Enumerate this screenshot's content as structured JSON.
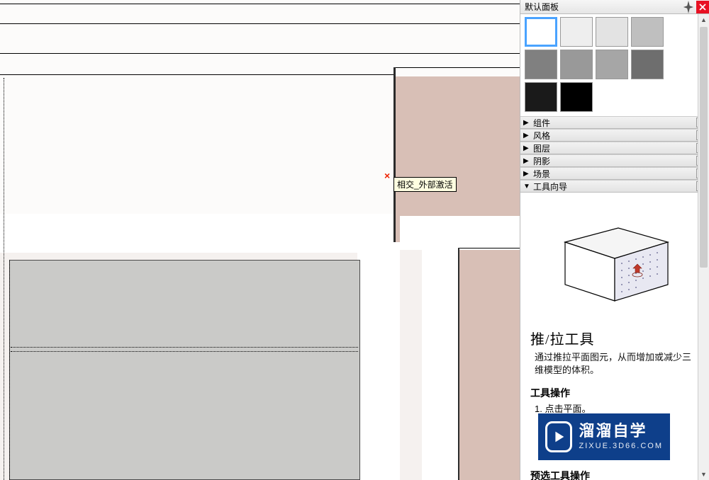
{
  "panel": {
    "title": "默认面板",
    "swatches": [
      [
        "#ffffff",
        "#eeeeee",
        "#e3e3e3",
        "#bfbfbf"
      ],
      [
        "#808080",
        "#999999",
        "#a6a6a6",
        "#6e6e6e"
      ],
      [
        "#1a1a1a",
        "#000000"
      ]
    ],
    "selected_swatch": [
      0,
      0
    ]
  },
  "accordion": [
    {
      "label": "组件",
      "expanded": false
    },
    {
      "label": "风格",
      "expanded": false
    },
    {
      "label": "图层",
      "expanded": false
    },
    {
      "label": "阴影",
      "expanded": false
    },
    {
      "label": "场景",
      "expanded": false
    },
    {
      "label": "工具向导",
      "expanded": true
    }
  ],
  "instructor": {
    "tool_title": "推/拉工具",
    "tool_desc": "通过推拉平面图元，从而增加或减少三维模型的体积。",
    "ops_header": "工具操作",
    "steps": [
      "1. 点击平面。"
    ],
    "preselect_header": "预选工具操作"
  },
  "viewport": {
    "cursor_marker": "×",
    "tooltip": "相交_外部激活"
  },
  "watermark": {
    "cn": "溜溜自学",
    "en": "ZIXUE.3D66.COM"
  }
}
